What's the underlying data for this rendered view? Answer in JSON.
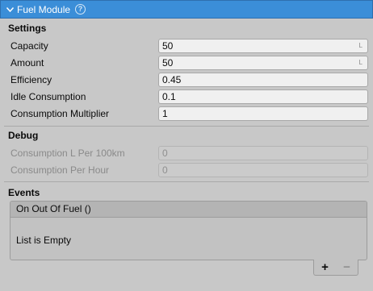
{
  "header": {
    "title": "Fuel Module",
    "help_glyph": "?"
  },
  "settings": {
    "title": "Settings",
    "fields": [
      {
        "label": "Capacity",
        "value": "50",
        "unit": "L"
      },
      {
        "label": "Amount",
        "value": "50",
        "unit": "L"
      },
      {
        "label": "Efficiency",
        "value": "0.45"
      },
      {
        "label": "Idle Consumption",
        "value": "0.1"
      },
      {
        "label": "Consumption Multiplier",
        "value": "1"
      }
    ]
  },
  "debug": {
    "title": "Debug",
    "fields": [
      {
        "label": "Consumption L Per 100km",
        "value": "0"
      },
      {
        "label": "Consumption Per Hour",
        "value": "0"
      }
    ]
  },
  "events": {
    "title": "Events",
    "event_name": "On Out Of Fuel ()",
    "empty_text": "List is Empty",
    "add_label": "+",
    "remove_label": "−"
  }
}
